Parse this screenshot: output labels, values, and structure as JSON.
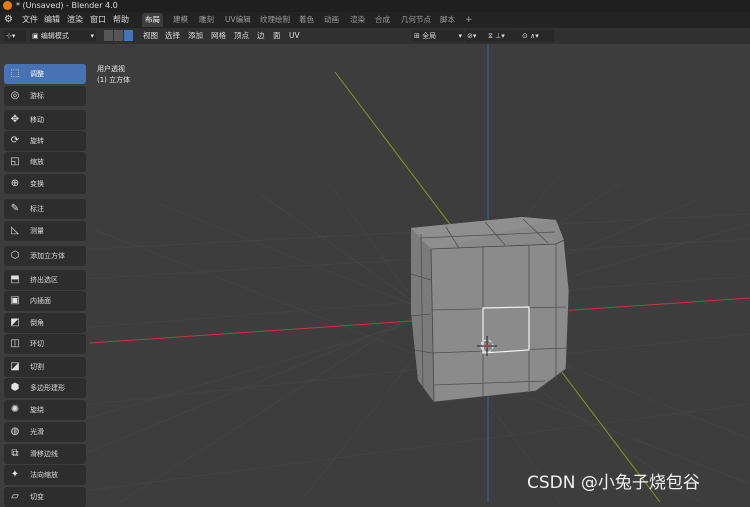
{
  "window": {
    "title": "* (Unsaved) - Blender 4.0"
  },
  "menubar": {
    "menus": [
      "文件",
      "编辑",
      "渲染",
      "窗口",
      "帮助"
    ],
    "workspaces": [
      "布局",
      "建模",
      "雕刻",
      "UV编辑",
      "纹理绘制",
      "着色",
      "动画",
      "渲染",
      "合成",
      "几何节点",
      "脚本"
    ],
    "active_workspace": "布局",
    "add_tab": "+"
  },
  "header": {
    "mode": "编辑模式",
    "menus": [
      "视图",
      "选择",
      "添加",
      "网格",
      "顶点",
      "边",
      "面",
      "UV"
    ],
    "orientation": "全局"
  },
  "viewport": {
    "view_label": "用户透视",
    "object_label": "(1) 立方体"
  },
  "toolbar": {
    "tools": [
      {
        "label": "调整",
        "icon": "select-box-icon",
        "active": true
      },
      {
        "label": "游标",
        "icon": "cursor-icon",
        "active": false
      },
      {
        "label": "移动",
        "icon": "move-icon",
        "active": false
      },
      {
        "label": "旋转",
        "icon": "rotate-icon",
        "active": false
      },
      {
        "label": "缩放",
        "icon": "scale-icon",
        "active": false
      },
      {
        "label": "变换",
        "icon": "transform-icon",
        "active": false
      },
      {
        "label": "标注",
        "icon": "annotate-icon",
        "active": false
      },
      {
        "label": "测量",
        "icon": "measure-icon",
        "active": false
      },
      {
        "label": "添加立方体",
        "icon": "add-cube-icon",
        "active": false
      },
      {
        "label": "挤出选区",
        "icon": "extrude-icon",
        "active": false
      },
      {
        "label": "内插面",
        "icon": "inset-icon",
        "active": false
      },
      {
        "label": "倒角",
        "icon": "bevel-icon",
        "active": false
      },
      {
        "label": "环切",
        "icon": "loop-cut-icon",
        "active": false
      },
      {
        "label": "切割",
        "icon": "knife-icon",
        "active": false
      },
      {
        "label": "多边形建形",
        "icon": "poly-build-icon",
        "active": false
      },
      {
        "label": "旋绕",
        "icon": "spin-icon",
        "active": false
      },
      {
        "label": "光滑",
        "icon": "smooth-icon",
        "active": false
      },
      {
        "label": "滑移边线",
        "icon": "edge-slide-icon",
        "active": false
      },
      {
        "label": "法向缩放",
        "icon": "shrink-fatten-icon",
        "active": false
      },
      {
        "label": "切变",
        "icon": "shear-icon",
        "active": false
      }
    ]
  },
  "watermark": "CSDN @小兔子烧包谷",
  "colors": {
    "accent": "#4772b3",
    "background": "#3d3d3d",
    "x_axis": "#c0383f",
    "y_axis": "#7a9a1c",
    "z_axis": "#3d63a8",
    "logo": "#e87d0d"
  }
}
